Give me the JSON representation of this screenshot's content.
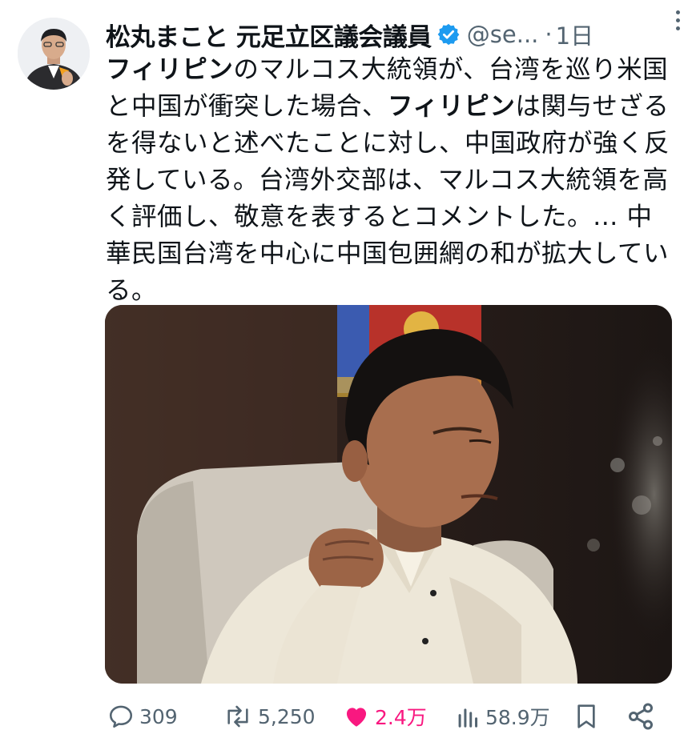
{
  "author": {
    "display_name": "松丸まこと 元足立区議会議員",
    "handle": "@se...",
    "separator": "·",
    "time": "1日",
    "verified": true
  },
  "tweet": {
    "segments": [
      {
        "text": "フィリピン",
        "bold": true
      },
      {
        "text": "のマルコス大統領が、台湾を巡り米国と中国が衝突した場合、",
        "bold": false
      },
      {
        "text": "フィリピン",
        "bold": true
      },
      {
        "text": "は関与せざるを得ないと述べたことに対し、中国政府が強く反発している。台湾外交部は、マルコス大統領を高く評価し、敬意を表するとコメントした。… 中華民国台湾を中心に中国包囲網の和が拡大している。",
        "bold": false
      }
    ]
  },
  "actions": {
    "reply": {
      "count": "309",
      "icon": "reply-icon"
    },
    "retweet": {
      "count": "5,250",
      "icon": "retweet-icon"
    },
    "like": {
      "count": "2.4万",
      "icon": "heart-icon",
      "liked": true
    },
    "views": {
      "count": "58.9万",
      "icon": "views-icon"
    },
    "bookmark": {
      "icon": "bookmark-icon"
    },
    "share": {
      "icon": "share-icon"
    }
  },
  "colors": {
    "secondary_text": "#536471",
    "verified_blue": "#1d9bf0",
    "like_pink": "#f91880"
  }
}
